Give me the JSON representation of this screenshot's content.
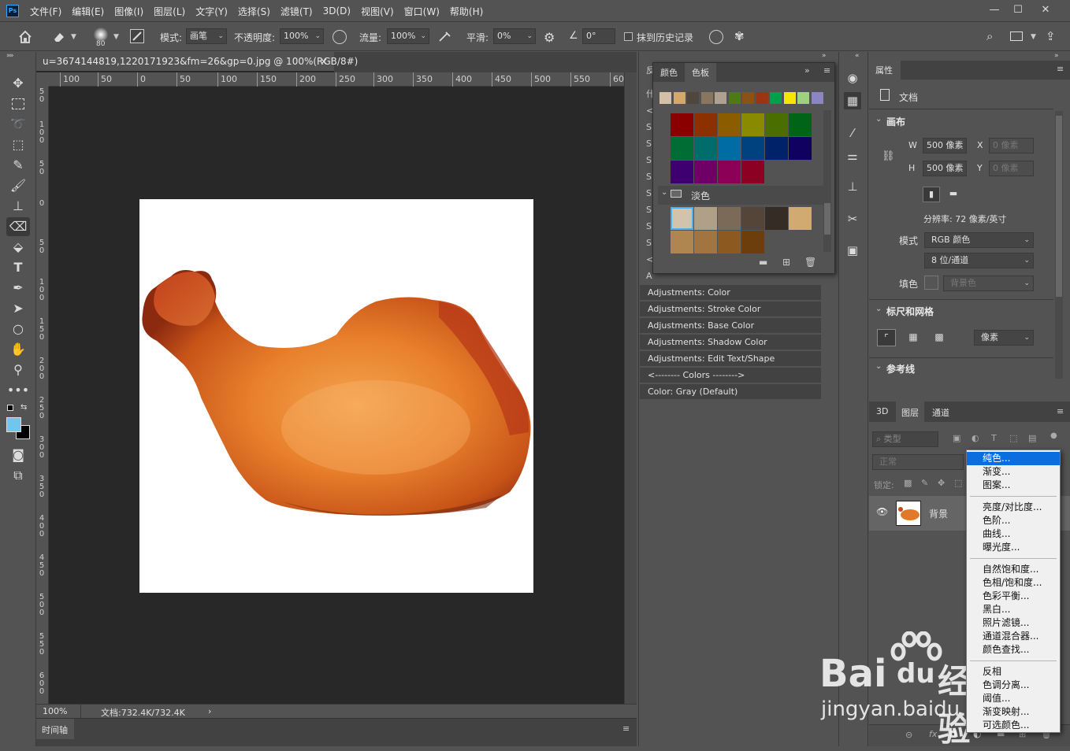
{
  "app": {
    "logo": "Ps",
    "menus": [
      "文件(F)",
      "编辑(E)",
      "图像(I)",
      "图层(L)",
      "文字(Y)",
      "选择(S)",
      "滤镜(T)",
      "3D(D)",
      "视图(V)",
      "窗口(W)",
      "帮助(H)"
    ]
  },
  "options": {
    "brush_size": "80",
    "mode_label": "模式:",
    "mode_value": "画笔",
    "opacity_label": "不透明度:",
    "opacity_value": "100%",
    "flow_label": "流量:",
    "flow_value": "100%",
    "smooth_label": "平滑:",
    "smooth_value": "0%",
    "angle_value": "0°",
    "erase_history_label": "抹到历史记录"
  },
  "document": {
    "tab_title": "u=3674144819,1220171923&fm=26&gp=0.jpg @ 100%(RGB/8#)",
    "zoom": "100%",
    "doc_info": "文档:732.4K/732.4K"
  },
  "rulers": {
    "h_ticks": [
      "100",
      "50",
      "0",
      "50",
      "100",
      "150",
      "200",
      "250",
      "300",
      "350",
      "400",
      "450",
      "500",
      "550",
      "60"
    ],
    "v_ticks": [
      "50",
      "100",
      "50",
      "0",
      "50",
      "100",
      "150",
      "200",
      "250",
      "300",
      "350",
      "400",
      "450",
      "500",
      "550",
      "600"
    ]
  },
  "timeline": {
    "label": "时间轴"
  },
  "actions": {
    "left_letters": [
      "反",
      "什",
      "<",
      "S",
      "S",
      "S",
      "S",
      "S",
      "S",
      "S",
      "S",
      "<",
      "A"
    ],
    "items": [
      "Adjustments: Color",
      "Adjustments: Stroke Color",
      "Adjustments: Base Color",
      "Adjustments: Shadow Color",
      "Adjustments: Edit Text/Shape",
      "<-------- Colors -------->",
      "Color: Gray (Default)"
    ]
  },
  "swatches": {
    "tab_color": "颜色",
    "tab_swatches": "色板",
    "group_light": "淡色",
    "recent": [
      "#d4c0a6",
      "#d4a86a",
      "#4f463d",
      "#8a7560",
      "#b0a090",
      "#4e7a16",
      "#8a5214",
      "#9c3312",
      "#00a04a",
      "#f5e600",
      "#9ed080",
      "#8c86c0"
    ],
    "dark_rows": [
      [
        "#8a0000",
        "#8c3000",
        "#8c5c00",
        "#8a8a00",
        "#4a6e00",
        "#006418"
      ],
      [
        "#006e34",
        "#006c6c",
        "#006ca4",
        "#004280",
        "#002268",
        "#100060"
      ],
      [
        "#3e0070",
        "#6e0068",
        "#8c0058",
        "#8c0024"
      ]
    ],
    "light_rows": [
      [
        "#d2c3ad",
        "#b0a088",
        "#7c6a58",
        "#544538",
        "#352c25",
        "#d0aa70"
      ],
      [
        "#b08650",
        "#a27440",
        "#8c5a20",
        "#6c3e0c"
      ]
    ]
  },
  "properties": {
    "tab": "属性",
    "doc_label": "文档",
    "canvas_section": "画布",
    "w_label": "W",
    "w_value": "500 像素",
    "h_label": "H",
    "h_value": "500 像素",
    "x_label": "X",
    "x_value": "0 像素",
    "y_label": "Y",
    "y_value": "0 像素",
    "resolution": "分辨率: 72 像素/英寸",
    "mode_label": "模式",
    "mode_value": "RGB 颜色",
    "depth_value": "8 位/通道",
    "fill_label": "填色",
    "fill_value": "背景色",
    "rulers_section": "标尺和网格",
    "unit_value": "像素",
    "guides_section": "参考线"
  },
  "layers": {
    "tab_3d": "3D",
    "tab_layers": "图层",
    "tab_channels": "通道",
    "filter_placeholder": "类型",
    "blend_mode": "正常",
    "lock_label": "锁定:",
    "layer_name": "背景"
  },
  "adjust_menu": {
    "groups": [
      [
        "纯色...",
        "渐变...",
        "图案..."
      ],
      [
        "亮度/对比度...",
        "色阶...",
        "曲线...",
        "曝光度..."
      ],
      [
        "自然饱和度...",
        "色相/饱和度...",
        "色彩平衡...",
        "黑白...",
        "照片滤镜...",
        "通道混合器...",
        "颜色查找..."
      ],
      [
        "反相",
        "色调分离...",
        "阈值...",
        "渐变映射...",
        "可选颜色..."
      ]
    ],
    "highlighted": "纯色..."
  },
  "watermark": {
    "line1": "Bai",
    "line1b": "du",
    "line1c": "经验",
    "line2": "jingyan.baidu.com"
  }
}
